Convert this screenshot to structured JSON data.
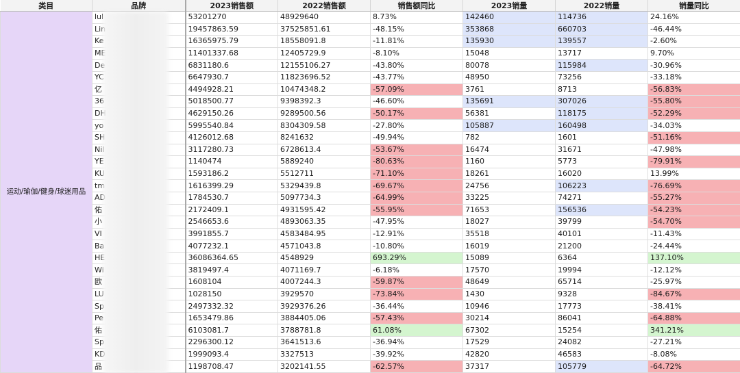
{
  "headers": [
    "类目",
    "品牌",
    "2023销售额",
    "2022销售额",
    "销售额同比",
    "2023销量",
    "2022销量",
    "销量同比"
  ],
  "category": "运动/瑜伽/健身/球迷用品",
  "colors": {
    "category_bg": "#e6d6f8",
    "red": "#f7b1b4",
    "green": "#d4f5cf",
    "blue": "#dde5fb"
  },
  "rows": [
    {
      "brand": "lul",
      "s23": "53201270",
      "s22": "48929640",
      "syoy": "8.73%",
      "v23": "142460",
      "v22": "114736",
      "vyoy": "24.16%",
      "hl": {
        "v23": "blue",
        "v22": "blue"
      }
    },
    {
      "brand": "Lin",
      "s23": "19457863.59",
      "s22": "37525851.61",
      "syoy": "-48.15%",
      "v23": "353868",
      "v22": "660703",
      "vyoy": "-46.44%",
      "hl": {
        "v23": "blue",
        "v22": "blue"
      }
    },
    {
      "brand": "Ke",
      "s23": "16365975.79",
      "s22": "18558091.8",
      "syoy": "-11.81%",
      "v23": "135930",
      "v22": "139557",
      "vyoy": "-2.60%",
      "hl": {
        "v23": "blue",
        "v22": "blue"
      }
    },
    {
      "brand": "ME",
      "s23": "11401337.68",
      "s22": "12405729.9",
      "syoy": "-8.10%",
      "v23": "15048",
      "v22": "13717",
      "vyoy": "9.70%",
      "hl": {}
    },
    {
      "brand": "De",
      "s23": "6831180.6",
      "s22": "12155106.27",
      "syoy": "-43.80%",
      "v23": "80078",
      "v22": "115984",
      "vyoy": "-30.96%",
      "hl": {
        "v22": "blue"
      }
    },
    {
      "brand": "YC",
      "s23": "6647930.7",
      "s22": "11823696.52",
      "syoy": "-43.77%",
      "v23": "48950",
      "v22": "73256",
      "vyoy": "-33.18%",
      "hl": {}
    },
    {
      "brand": "亿",
      "s23": "4494928.21",
      "s22": "10474348.2",
      "syoy": "-57.09%",
      "v23": "3761",
      "v22": "8713",
      "vyoy": "-56.83%",
      "hl": {
        "syoy": "red",
        "vyoy": "red"
      }
    },
    {
      "brand": "36",
      "s23": "5018500.77",
      "s22": "9398392.3",
      "syoy": "-46.60%",
      "v23": "135691",
      "v22": "307026",
      "vyoy": "-55.80%",
      "hl": {
        "v23": "blue",
        "v22": "blue",
        "vyoy": "red"
      }
    },
    {
      "brand": "DH",
      "s23": "4629150.26",
      "s22": "9289500.56",
      "syoy": "-50.17%",
      "v23": "56381",
      "v22": "118175",
      "vyoy": "-52.29%",
      "hl": {
        "syoy": "red",
        "v22": "blue",
        "vyoy": "red"
      }
    },
    {
      "brand": "yo",
      "s23": "5995540.84",
      "s22": "8304309.58",
      "syoy": "-27.80%",
      "v23": "105887",
      "v22": "160498",
      "vyoy": "-34.03%",
      "hl": {
        "v23": "blue",
        "v22": "blue"
      }
    },
    {
      "brand": "SH",
      "s23": "4126012.68",
      "s22": "8241632",
      "syoy": "-49.94%",
      "v23": "782",
      "v22": "1601",
      "vyoy": "-51.16%",
      "hl": {
        "vyoy": "red"
      }
    },
    {
      "brand": "Nil",
      "s23": "3117280.73",
      "s22": "6728613.4",
      "syoy": "-53.67%",
      "v23": "16474",
      "v22": "31671",
      "vyoy": "-47.98%",
      "hl": {
        "syoy": "red"
      }
    },
    {
      "brand": "YE",
      "s23": "1140474",
      "s22": "5889240",
      "syoy": "-80.63%",
      "v23": "1160",
      "v22": "5773",
      "vyoy": "-79.91%",
      "hl": {
        "syoy": "red",
        "vyoy": "red"
      }
    },
    {
      "brand": "KU",
      "s23": "1593186.2",
      "s22": "5512711",
      "syoy": "-71.10%",
      "v23": "18261",
      "v22": "16020",
      "vyoy": "13.99%",
      "hl": {
        "syoy": "red"
      }
    },
    {
      "brand": "tm",
      "s23": "1616399.29",
      "s22": "5329439.8",
      "syoy": "-69.67%",
      "v23": "24756",
      "v22": "106223",
      "vyoy": "-76.69%",
      "hl": {
        "syoy": "red",
        "v22": "blue",
        "vyoy": "red"
      }
    },
    {
      "brand": "AD",
      "s23": "1784530.7",
      "s22": "5097734.3",
      "syoy": "-64.99%",
      "v23": "33225",
      "v22": "74271",
      "vyoy": "-55.27%",
      "hl": {
        "syoy": "red",
        "vyoy": "red"
      }
    },
    {
      "brand": "佑",
      "s23": "2172409.1",
      "s22": "4931595.42",
      "syoy": "-55.95%",
      "v23": "71653",
      "v22": "156536",
      "vyoy": "-54.23%",
      "hl": {
        "syoy": "red",
        "v22": "blue",
        "vyoy": "red"
      }
    },
    {
      "brand": "小",
      "s23": "2546653.6",
      "s22": "4893063.35",
      "syoy": "-47.95%",
      "v23": "18027",
      "v22": "39799",
      "vyoy": "-54.70%",
      "hl": {
        "vyoy": "red"
      }
    },
    {
      "brand": "VI",
      "s23": "3991855.7",
      "s22": "4583484.95",
      "syoy": "-12.91%",
      "v23": "35518",
      "v22": "40101",
      "vyoy": "-11.43%",
      "hl": {}
    },
    {
      "brand": "Ba",
      "s23": "4077232.1",
      "s22": "4571043.8",
      "syoy": "-10.80%",
      "v23": "16019",
      "v22": "21200",
      "vyoy": "-24.44%",
      "hl": {}
    },
    {
      "brand": "HE",
      "s23": "36086364.65",
      "s22": "4548929",
      "syoy": "693.29%",
      "v23": "15089",
      "v22": "6364",
      "vyoy": "137.10%",
      "hl": {
        "syoy": "green",
        "vyoy": "green"
      }
    },
    {
      "brand": "Wi",
      "s23": "3819497.4",
      "s22": "4071169.7",
      "syoy": "-6.18%",
      "v23": "17570",
      "v22": "19994",
      "vyoy": "-12.12%",
      "hl": {}
    },
    {
      "brand": "欧",
      "s23": "1608104",
      "s22": "4007244.3",
      "syoy": "-59.87%",
      "v23": "48649",
      "v22": "65714",
      "vyoy": "-25.97%",
      "hl": {
        "syoy": "red"
      }
    },
    {
      "brand": "LU",
      "s23": "1028150",
      "s22": "3929570",
      "syoy": "-73.84%",
      "v23": "1430",
      "v22": "9328",
      "vyoy": "-84.67%",
      "hl": {
        "syoy": "red",
        "vyoy": "red"
      }
    },
    {
      "brand": "Sp",
      "s23": "2497332.32",
      "s22": "3929376.26",
      "syoy": "-36.44%",
      "v23": "10946",
      "v22": "17773",
      "vyoy": "-38.41%",
      "hl": {}
    },
    {
      "brand": "Pe",
      "s23": "1653479.86",
      "s22": "3884405.06",
      "syoy": "-57.43%",
      "v23": "30214",
      "v22": "86041",
      "vyoy": "-64.88%",
      "hl": {
        "syoy": "red",
        "vyoy": "red"
      }
    },
    {
      "brand": "佑",
      "s23": "6103081.7",
      "s22": "3788781.8",
      "syoy": "61.08%",
      "v23": "67302",
      "v22": "15254",
      "vyoy": "341.21%",
      "hl": {
        "syoy": "green",
        "vyoy": "green"
      }
    },
    {
      "brand": "Sp",
      "s23": "2296300.12",
      "s22": "3641513.6",
      "syoy": "-36.94%",
      "v23": "17529",
      "v22": "24082",
      "vyoy": "-27.21%",
      "hl": {}
    },
    {
      "brand": "KD",
      "s23": "1999093.4",
      "s22": "3327513",
      "syoy": "-39.92%",
      "v23": "42820",
      "v22": "46583",
      "vyoy": "-8.08%",
      "hl": {}
    },
    {
      "brand": "品",
      "s23": "1198708.47",
      "s22": "3202141.55",
      "syoy": "-62.57%",
      "v23": "37317",
      "v22": "105779",
      "vyoy": "-64.72%",
      "hl": {
        "syoy": "red",
        "v22": "blue",
        "vyoy": "red"
      }
    }
  ]
}
